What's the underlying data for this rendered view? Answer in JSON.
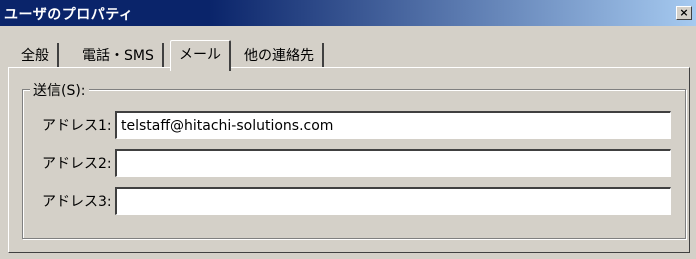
{
  "window": {
    "title": "ユーザのプロパティ",
    "close_label": "×"
  },
  "tabs": [
    {
      "label": "全般"
    },
    {
      "label": "電話・SMS"
    },
    {
      "label": "メール"
    },
    {
      "label": "他の連絡先"
    }
  ],
  "send_group": {
    "label": "送信(S):",
    "fields": [
      {
        "label": "アドレス1:",
        "value": "telstaff@hitachi-solutions.com"
      },
      {
        "label": "アドレス2:",
        "value": ""
      },
      {
        "label": "アドレス3:",
        "value": ""
      }
    ]
  }
}
